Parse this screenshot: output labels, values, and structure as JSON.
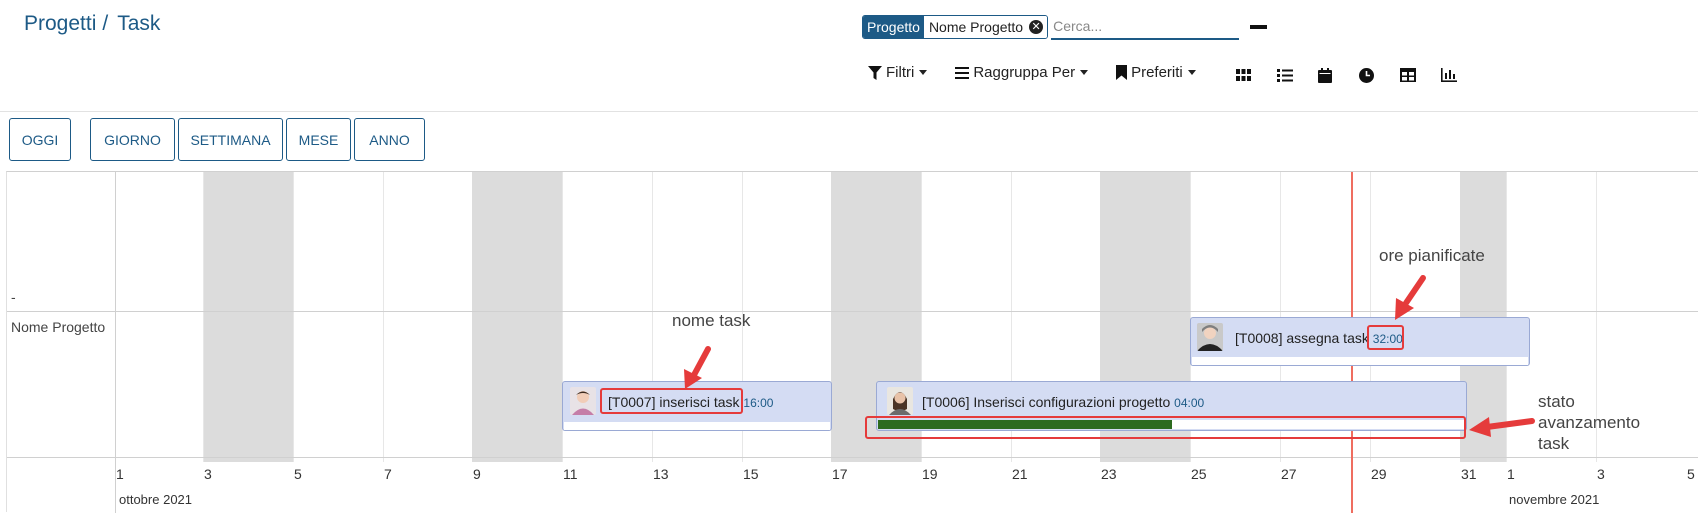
{
  "breadcrumb": {
    "parent": "Progetti",
    "separator": "/",
    "current": "Task"
  },
  "search": {
    "facet_label": "Progetto",
    "facet_value": "Nome Progetto",
    "placeholder": "Cerca..."
  },
  "filters": {
    "filtri": "Filtri",
    "raggruppa": "Raggruppa Per",
    "preferiti": "Preferiti"
  },
  "view_switcher": [
    "kanban-icon",
    "list-icon",
    "calendar-icon",
    "clock-icon",
    "pivot-icon",
    "graph-icon"
  ],
  "scale_buttons": {
    "oggi": "OGGI",
    "giorno": "GIORNO",
    "settimana": "SETTIMANA",
    "mese": "MESE",
    "anno": "ANNO"
  },
  "gantt": {
    "header_label": "-",
    "group_label": "Nome Progetto",
    "date_labels": [
      "1",
      "3",
      "5",
      "7",
      "9",
      "11",
      "13",
      "15",
      "17",
      "19",
      "21",
      "23",
      "25",
      "27",
      "29",
      "31",
      "1",
      "3",
      "5"
    ],
    "months": [
      "ottobre 2021",
      "novembre 2021"
    ],
    "tasks": [
      {
        "id": "T0008",
        "label": "[T0008] assegna task",
        "hours": "32:00"
      },
      {
        "id": "T0007",
        "label": "[T0007] inserisci task",
        "hours": "16:00"
      },
      {
        "id": "T0006",
        "label": "[T0006] Inserisci configurazioni progetto",
        "hours": "04:00",
        "progress": 0.5
      }
    ]
  },
  "annotations": {
    "nome_task": "nome task",
    "ore_pianificate": "ore pianificate",
    "stato_line1": "stato",
    "stato_line2": "avanzamento",
    "stato_line3": "task"
  },
  "colors": {
    "brand": "#1d5a86",
    "weekend": "#dcdcdc",
    "task_bar": "#d4dcf3",
    "progress": "#2c6b1f",
    "today_line": "#ef6d60",
    "annotation": "#e53b3b"
  }
}
